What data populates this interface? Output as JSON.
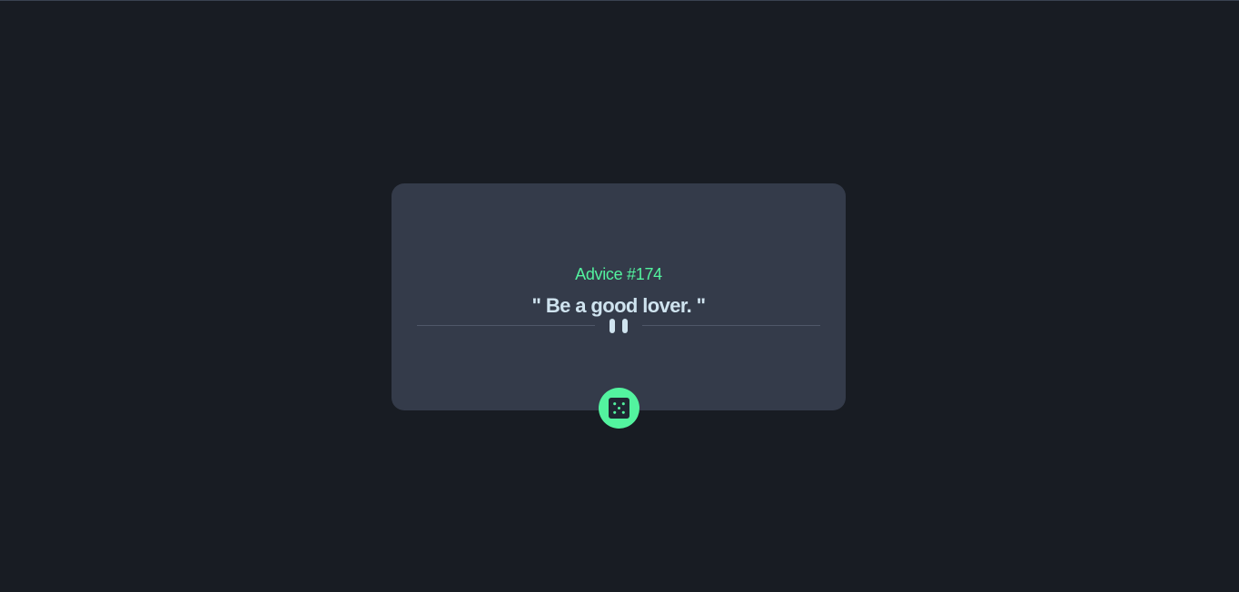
{
  "advice": {
    "id_label": "Advice #174",
    "text": "\" Be a good lover. \""
  },
  "icons": {
    "divider": "pause-icon",
    "generate": "dice-icon"
  },
  "colors": {
    "background": "#181c23",
    "card": "#343b4a",
    "accent": "#53f39f",
    "text": "#cfe3ef"
  }
}
